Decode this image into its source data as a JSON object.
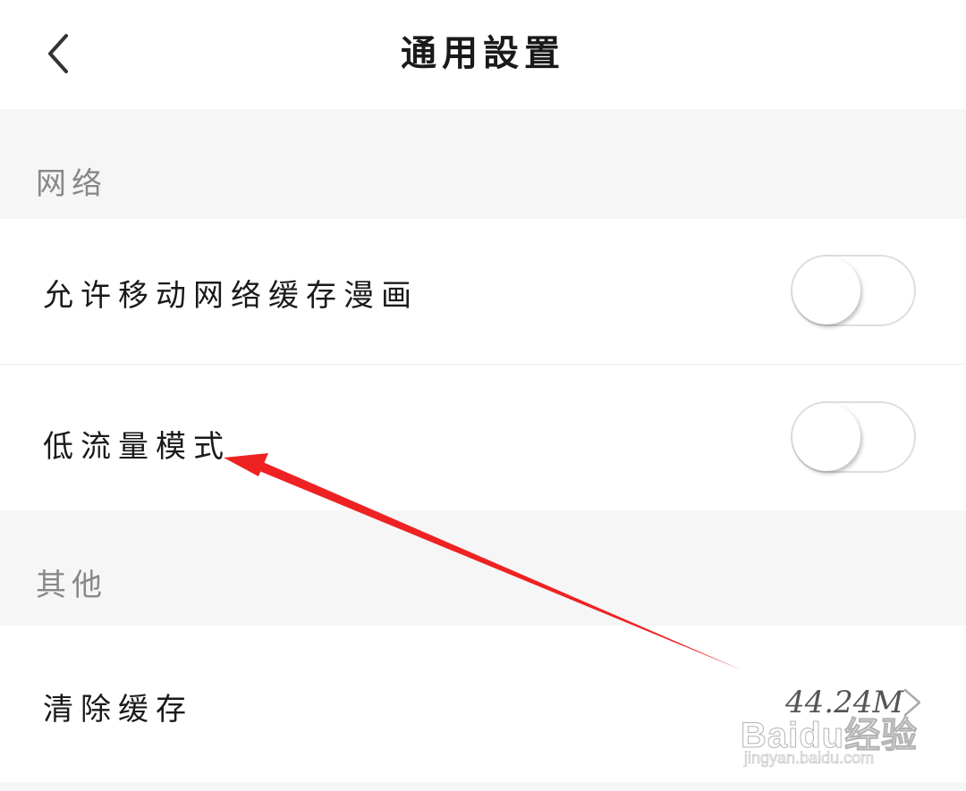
{
  "header": {
    "title": "通用設置",
    "back_icon": "chevron-left-icon"
  },
  "sections": [
    {
      "label": "网络",
      "rows": [
        {
          "label": "允许移动网络缓存漫画",
          "toggle": "off"
        },
        {
          "label": "低流量模式",
          "toggle": "off"
        }
      ]
    },
    {
      "label": "其他",
      "rows": [
        {
          "label": "清除缓存",
          "value": "44.24M",
          "chevron_icon": "chevron-right-icon"
        }
      ]
    }
  ],
  "annotation": {
    "type": "arrow",
    "color": "#ee2222",
    "target": "低流量模式"
  },
  "watermark": {
    "brand": "Baidu经验",
    "url": "jingyan.baidu.com"
  }
}
